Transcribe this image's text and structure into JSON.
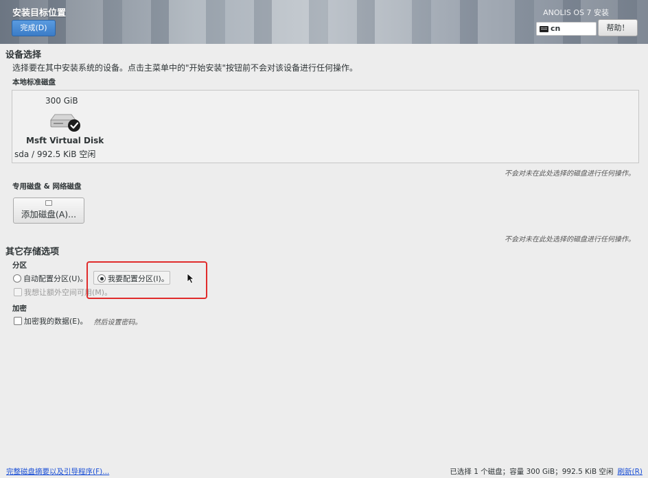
{
  "header": {
    "title": "安装目标位置",
    "done_label": "完成(D)",
    "product": "ANOLIS OS 7 安装",
    "keyboard_layout": "cn",
    "help_label": "帮助！"
  },
  "device_selection": {
    "heading": "设备选择",
    "description": "选择要在其中安装系统的设备。点击主菜单中的\"开始安装\"按钮前不会对该设备进行任何操作。",
    "local_disks_label": "本地标准磁盘",
    "disk": {
      "size": "300 GiB",
      "name": "Msft Virtual Disk",
      "free": "sda / 992.5 KiB 空闲",
      "selected": true
    },
    "local_note": "不会对未在此处选择的磁盘进行任何操作。",
    "special_disks_label": "专用磁盘 & 网络磁盘",
    "add_disk_label": "添加磁盘(A)...",
    "special_note": "不会对未在此处选择的磁盘进行任何操作。"
  },
  "other_options": {
    "heading": "其它存储选项",
    "partition_label": "分区",
    "auto_partition": "自动配置分区(U)。",
    "manual_partition": "我要配置分区(I)。",
    "extra_space": "我想让额外空间可用(M)。",
    "encryption_label": "加密",
    "encrypt_data": "加密我的数据(E)。",
    "encrypt_hint": "然后设置密码。"
  },
  "footer": {
    "summary_link": "完整磁盘摘要以及引导程序(F)...",
    "status": "已选择 1 个磁盘；容量 300 GiB；992.5 KiB 空闲",
    "refresh_link": "刷新(R)"
  }
}
